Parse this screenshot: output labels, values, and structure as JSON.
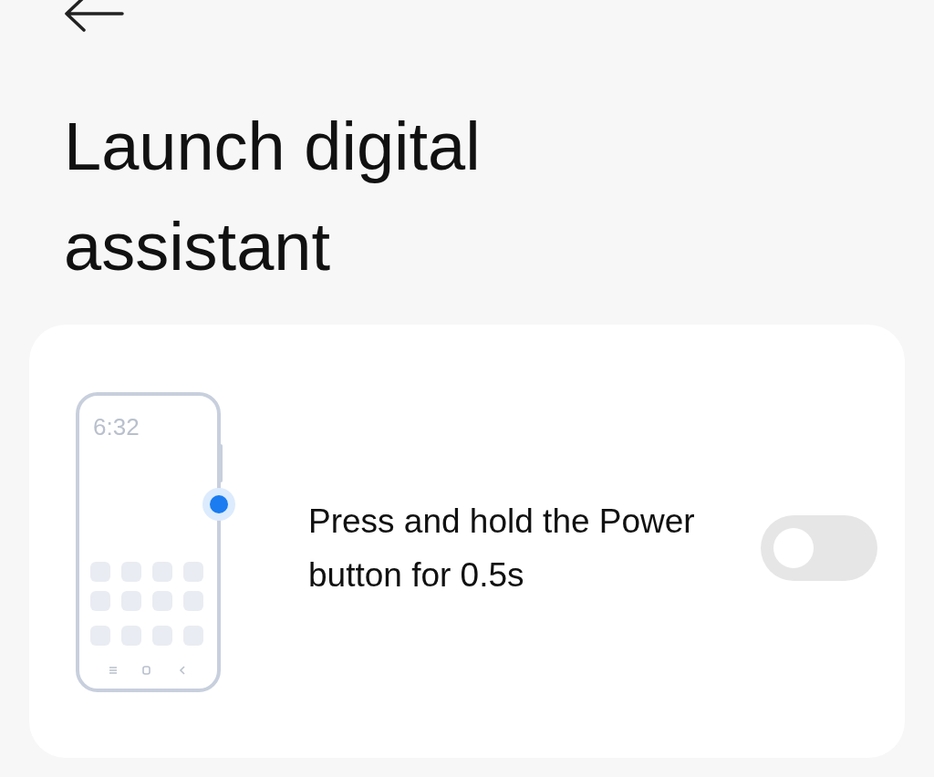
{
  "header": {
    "title": "Launch digital assistant"
  },
  "setting": {
    "illustration_time": "6:32",
    "label": "Press and hold the Power button for 0.5s",
    "on": false
  }
}
